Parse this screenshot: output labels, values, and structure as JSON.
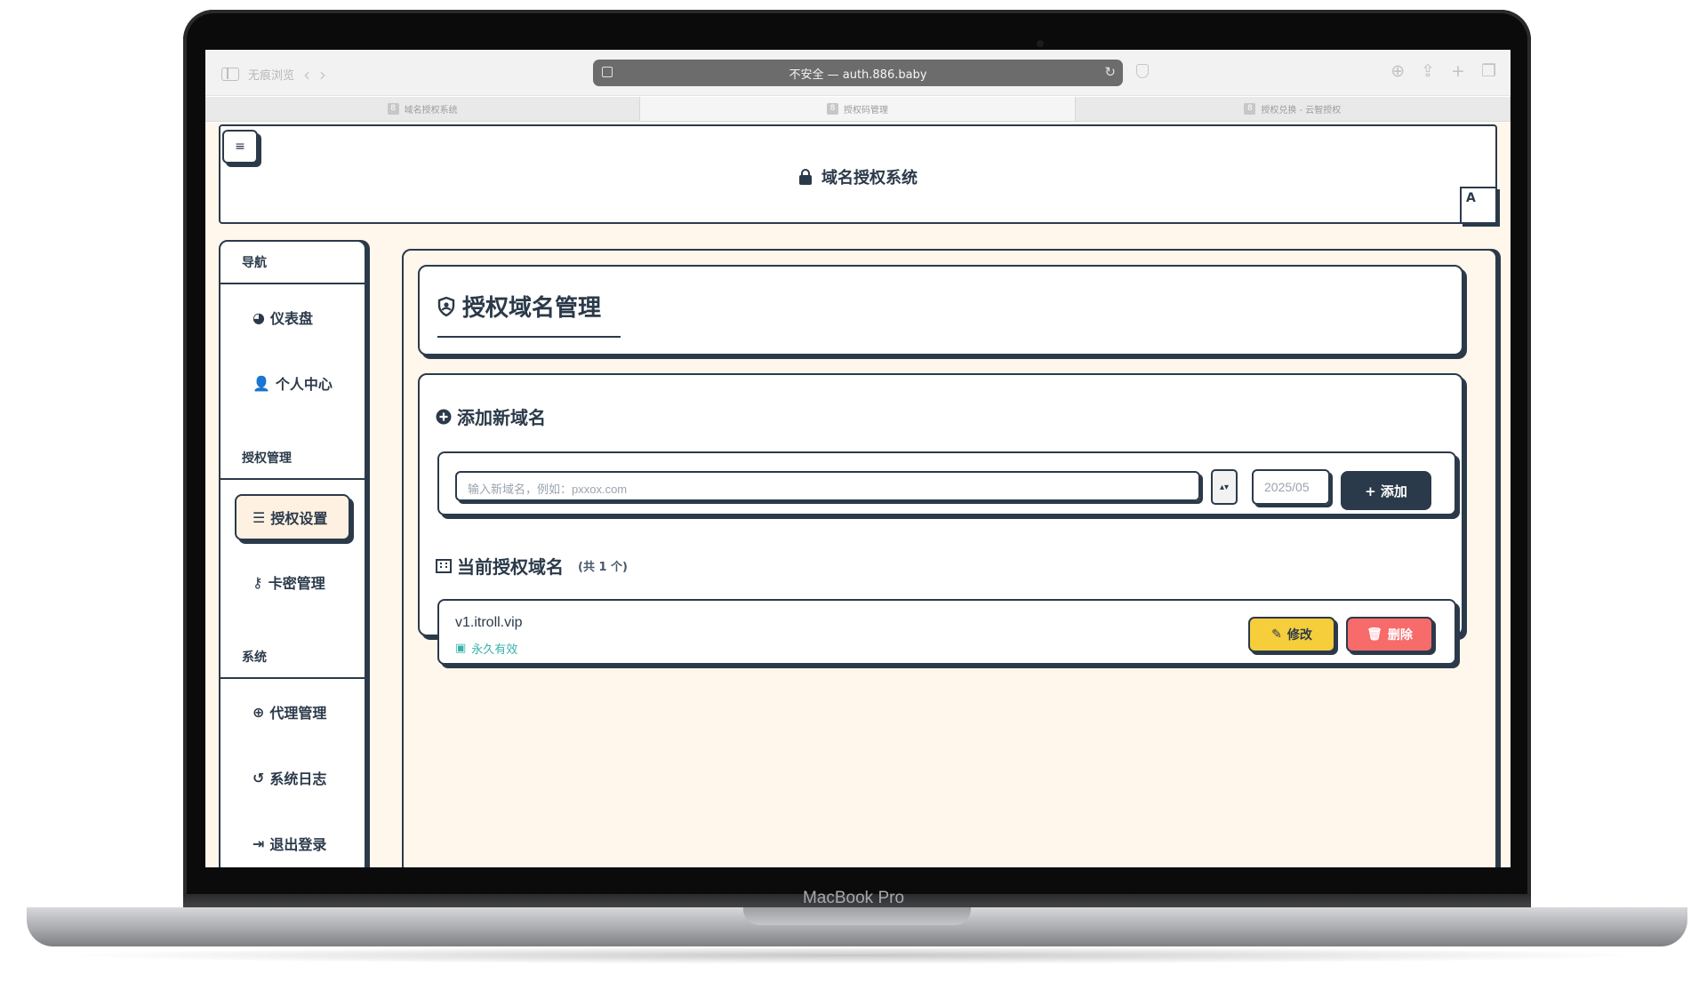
{
  "device": {
    "brand": "MacBook Pro"
  },
  "browser": {
    "private_label": "无痕浏览",
    "address": "不安全 — auth.886.baby",
    "tabs": [
      {
        "label": "域名授权系统",
        "active": false
      },
      {
        "label": "授权码管理",
        "active": true
      },
      {
        "label": "授权兑换 - 云智授权",
        "active": false
      }
    ]
  },
  "header": {
    "menu_icon": "≡",
    "title": "域名授权系统",
    "avatar_letter": "A"
  },
  "sidebar": {
    "sections": [
      {
        "title": "导航",
        "items": [
          {
            "label": "仪表盘",
            "icon": "chart-pie-icon",
            "active": false
          },
          {
            "label": "个人中心",
            "icon": "user-icon",
            "active": false
          }
        ]
      },
      {
        "title": "授权管理",
        "items": [
          {
            "label": "授权设置",
            "icon": "sliders-icon",
            "active": true
          },
          {
            "label": "卡密管理",
            "icon": "key-icon",
            "active": false
          }
        ]
      },
      {
        "title": "系统",
        "items": [
          {
            "label": "代理管理",
            "icon": "globe-icon",
            "active": false
          },
          {
            "label": "系统日志",
            "icon": "history-icon",
            "active": false
          },
          {
            "label": "退出登录",
            "icon": "sign-out-icon",
            "active": false
          }
        ]
      }
    ]
  },
  "main": {
    "page_title": "授权域名管理",
    "add_section_title": "添加新域名",
    "input_placeholder": "输入新域名，例如：pxxox.com",
    "date_value": "2025/05",
    "add_button": "+ 添加",
    "list_title": "当前授权域名",
    "list_count": "(共 1 个)",
    "domains": [
      {
        "name": "v1.itroll.vip",
        "status": "永久有效"
      }
    ],
    "edit_button": "修改",
    "delete_button": "删除"
  },
  "colors": {
    "primary": "#2b3a4a",
    "page_bg": "#fff6ec",
    "edit": "#f6cd3a",
    "delete": "#f76b6b",
    "status": "#38b2ac"
  }
}
